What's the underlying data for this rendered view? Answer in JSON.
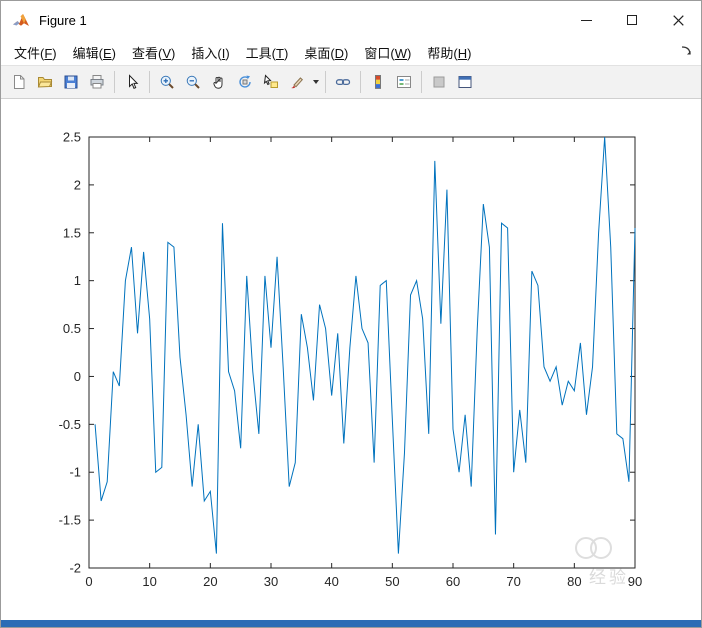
{
  "window": {
    "title": "Figure 1"
  },
  "menu": {
    "items": [
      {
        "key": "file",
        "label": "文件",
        "accel": "F"
      },
      {
        "key": "edit",
        "label": "编辑",
        "accel": "E"
      },
      {
        "key": "view",
        "label": "查看",
        "accel": "V"
      },
      {
        "key": "insert",
        "label": "插入",
        "accel": "I"
      },
      {
        "key": "tools",
        "label": "工具",
        "accel": "T"
      },
      {
        "key": "desktop",
        "label": "桌面",
        "accel": "D"
      },
      {
        "key": "window",
        "label": "窗口",
        "accel": "W"
      },
      {
        "key": "help",
        "label": "帮助",
        "accel": "H"
      }
    ]
  },
  "toolbar": {
    "items": [
      "new-figure",
      "open-file",
      "save-figure",
      "print-figure",
      "edit-plot",
      "zoom-in",
      "zoom-out",
      "pan",
      "rotate-3d",
      "data-cursor",
      "brush",
      "link-plot",
      "insert-colorbar",
      "insert-legend",
      "hide-plot-tools",
      "show-plot-tools-dock"
    ]
  },
  "colors": {
    "line": "#0072BD",
    "axis": "#262626",
    "toolbar_bg": "#f2f2f2",
    "bottom_bar": "#2b6cb5"
  },
  "watermark": {
    "text": "经验"
  },
  "chart_data": {
    "type": "line",
    "title": "",
    "xlabel": "",
    "ylabel": "",
    "xlim": [
      0,
      90
    ],
    "ylim": [
      -2,
      2.5
    ],
    "xticks": [
      0,
      10,
      20,
      30,
      40,
      50,
      60,
      70,
      80,
      90
    ],
    "yticks": [
      -2,
      -1.5,
      -1,
      -0.5,
      0,
      0.5,
      1,
      1.5,
      2,
      2.5
    ],
    "grid": false,
    "legend": null,
    "x_start": 1,
    "values": [
      -0.5,
      -1.3,
      -1.1,
      0.05,
      -0.1,
      1.0,
      1.35,
      0.45,
      1.3,
      0.6,
      -1.0,
      -0.95,
      1.4,
      1.35,
      0.2,
      -0.4,
      -1.15,
      -0.5,
      -1.3,
      -1.2,
      -1.85,
      1.6,
      0.05,
      -0.15,
      -0.75,
      1.05,
      0.05,
      -0.6,
      1.05,
      0.3,
      1.25,
      0.1,
      -1.15,
      -0.9,
      0.65,
      0.3,
      -0.25,
      0.75,
      0.5,
      -0.2,
      0.45,
      -0.7,
      0.3,
      1.05,
      0.5,
      0.35,
      -0.9,
      0.95,
      1.0,
      -0.45,
      -1.85,
      -0.8,
      0.85,
      1.0,
      0.6,
      -0.6,
      2.25,
      0.55,
      1.95,
      -0.55,
      -1.0,
      -0.4,
      -1.15,
      0.5,
      1.8,
      1.35,
      -1.65,
      1.6,
      1.55,
      -1.0,
      -0.35,
      -0.9,
      1.1,
      0.95,
      0.1,
      -0.05,
      0.1,
      -0.3,
      -0.05,
      -0.15,
      0.35,
      -0.4,
      0.1,
      1.5,
      2.5,
      1.35,
      -0.6,
      -0.65,
      -1.1,
      1.55
    ]
  }
}
